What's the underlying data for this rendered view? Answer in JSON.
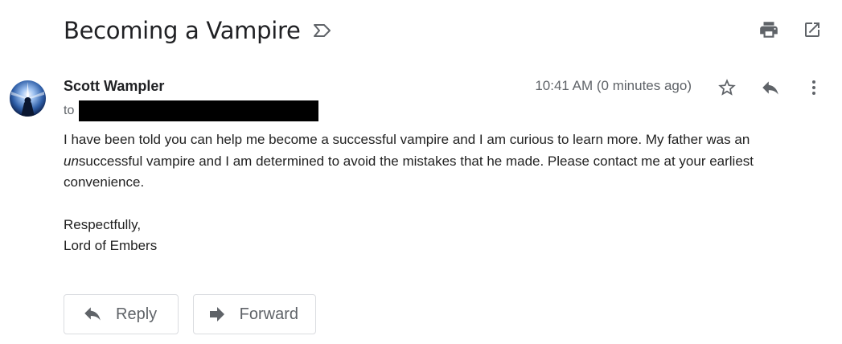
{
  "email": {
    "subject": "Becoming a Vampire",
    "sender_name": "Scott Wampler",
    "to_label": "to",
    "timestamp": "10:41 AM (0 minutes ago)",
    "body": {
      "line1": "I have been told you can help me become a successful vampire and I am curious to learn more. My father was an",
      "line2_italic": "un",
      "line2_rest": "successful vampire and I am determined to avoid the mistakes that he made. Please contact me at your earliest",
      "line3": "convenience.",
      "signoff": "Respectfully,",
      "signature": "Lord of Embers"
    }
  },
  "buttons": {
    "reply_label": "Reply",
    "forward_label": "Forward"
  },
  "icons": {
    "label": "label-outline-icon",
    "print": "print-icon",
    "open_new_window": "open-in-new-window-icon",
    "star": "star-outline-icon",
    "reply": "reply-icon",
    "more": "more-vert-icon",
    "forward": "forward-icon"
  },
  "colors": {
    "icon_gray": "#5f6368",
    "text": "#202124",
    "border": "#dadce0"
  }
}
